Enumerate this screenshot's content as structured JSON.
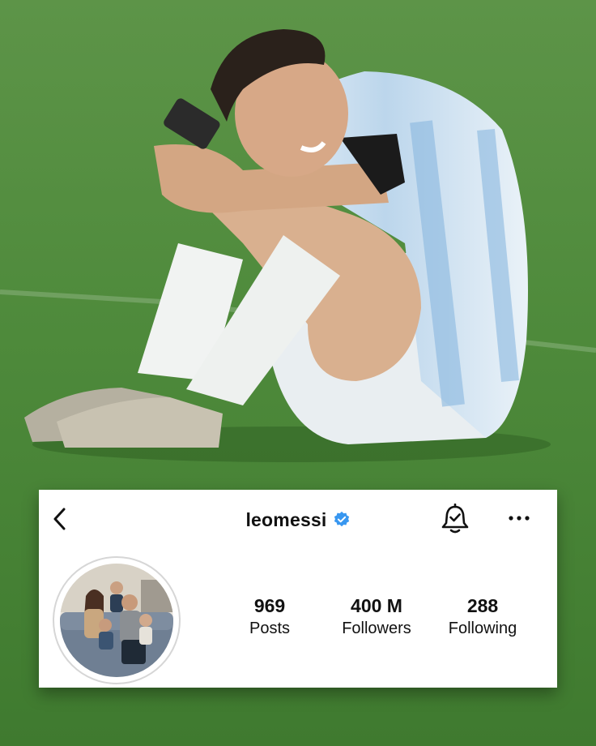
{
  "profile": {
    "username": "leomessi",
    "verified_icon": "verified-badge-icon",
    "avatar_description_icon": "family-photo-avatar"
  },
  "header": {
    "back_icon": "chevron-left-icon",
    "notify_icon": "bell-check-icon",
    "more_icon": "more-horizontal-icon"
  },
  "stats": [
    {
      "value": "969",
      "label": "Posts"
    },
    {
      "value": "400 M",
      "label": "Followers"
    },
    {
      "value": "288",
      "label": "Following"
    }
  ],
  "colors": {
    "verified": "#3897f0",
    "grass": "#4f8a3c",
    "card": "#ffffff",
    "text": "#111111"
  }
}
